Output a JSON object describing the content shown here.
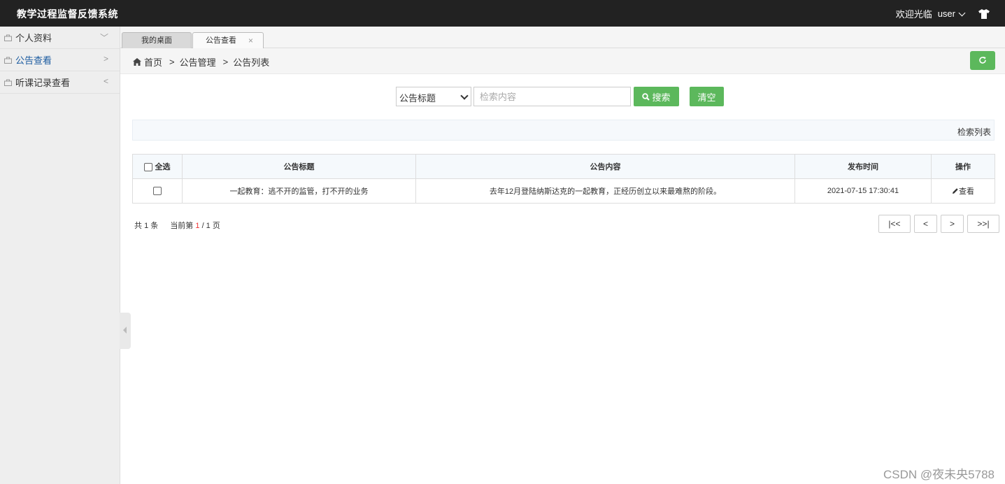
{
  "header": {
    "app_title": "教学过程监督反馈系统",
    "welcome": "欢迎光临",
    "username": "user"
  },
  "sidebar": {
    "items": [
      {
        "label": "个人资料",
        "arrow": "﹀"
      },
      {
        "label": "公告查看",
        "arrow": ">"
      },
      {
        "label": "听课记录查看",
        "arrow": "<"
      }
    ]
  },
  "tabs": [
    {
      "label": "我的桌面"
    },
    {
      "label": "公告查看",
      "close": "×"
    }
  ],
  "breadcrumb": {
    "home": "首页",
    "level1": "公告管理",
    "level2": "公告列表",
    "separator": ">"
  },
  "search": {
    "field_selected": "公告标题",
    "placeholder": "检索内容",
    "search_label": "搜索",
    "clear_label": "清空"
  },
  "result_bar_label": "检索列表",
  "table": {
    "select_all": "全选",
    "columns": [
      "公告标题",
      "公告内容",
      "发布时间",
      "操作"
    ],
    "rows": [
      {
        "title": "一起教育：逃不开的监管，打不开的业务",
        "content": "去年12月登陆纳斯达克的一起教育，正经历创立以来最难熬的阶段。",
        "time": "2021-07-15 17:30:41",
        "action": "查看"
      }
    ]
  },
  "pagination": {
    "total_prefix": "共",
    "total": "1",
    "total_suffix": "条",
    "current_prefix": "当前第",
    "current": "1",
    "pages_text": "/ 1 页",
    "first": "|<<",
    "prev": "<",
    "next": ">",
    "last": ">>|"
  },
  "watermark": "CSDN @夜未央5788",
  "colors": {
    "topbar": "#222222",
    "accent_green": "#5cb85c",
    "sidebar_active": "#1b5ba0",
    "current_page": "#ee3333"
  }
}
